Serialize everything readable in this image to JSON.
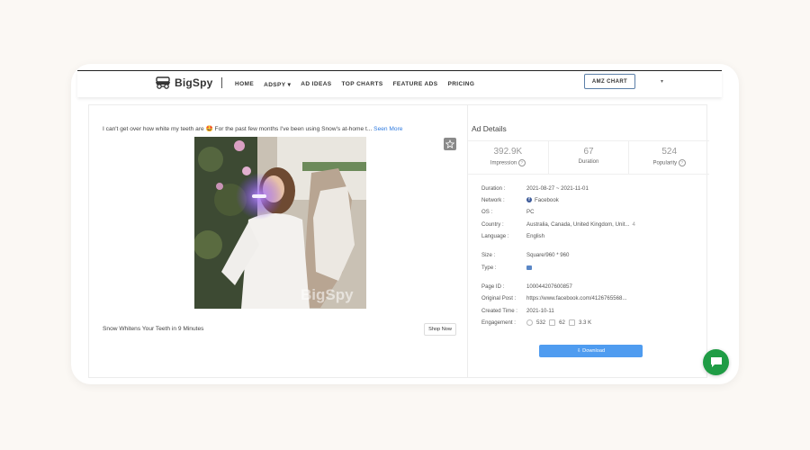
{
  "brand": {
    "name": "BigSpy",
    "accent": "#4f9cf0",
    "chat_color": "#1f9c45"
  },
  "nav": {
    "items": [
      "HOME",
      "ADSPY",
      "AD IDEAS",
      "TOP CHARTS",
      "FEATURE ADS",
      "PRICING"
    ],
    "adspy_caret": "▾",
    "amz_button": "AMZ CHART",
    "extra_caret": "▾"
  },
  "ad": {
    "text": "I can't get over how white my teeth are 🤩 For the past few months I've been using Snow's at-home t...",
    "see_more": "Seen More",
    "watermark": "BigSpy",
    "headline": "Snow Whitens Your Teeth in 9 Minutes",
    "cta": "Shop Now"
  },
  "details": {
    "title": "Ad Details",
    "stats": [
      {
        "value": "392.9K",
        "label": "Impression",
        "help": true
      },
      {
        "value": "67",
        "label": "Duration",
        "help": false
      },
      {
        "value": "524",
        "label": "Popularity",
        "help": true
      }
    ],
    "rows": {
      "duration": {
        "k": "Duration :",
        "v": "2021-08-27 ~ 2021-11-01"
      },
      "network": {
        "k": "Network :",
        "v": "Facebook"
      },
      "os": {
        "k": "OS :",
        "v": "PC"
      },
      "country": {
        "k": "Country :",
        "v": "Australia, Canada, United Kingdom, Unit...",
        "extra": "4"
      },
      "language": {
        "k": "Language :",
        "v": "English"
      },
      "size": {
        "k": "Size :",
        "v": "Square/960 * 960"
      },
      "type": {
        "k": "Type :"
      },
      "page_id": {
        "k": "Page ID :",
        "v": "100044207600857"
      },
      "original_post": {
        "k": "Original Post :",
        "v": "https://www.facebook.com/4126765568..."
      },
      "created_time": {
        "k": "Created Time :",
        "v": "2021-10-11"
      },
      "engagement": {
        "k": "Engagement :",
        "likes": "532",
        "comments": "62",
        "shares": "3.3 K"
      }
    },
    "download": "⇩ Download"
  }
}
